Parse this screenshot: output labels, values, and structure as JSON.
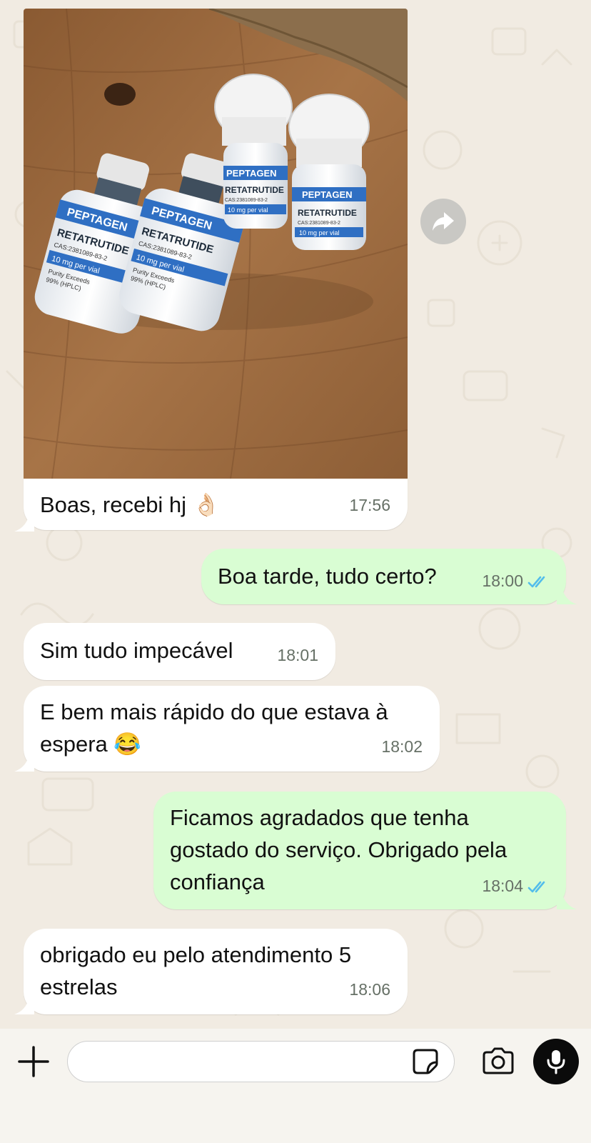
{
  "messages": [
    {
      "id": "m1",
      "dir": "in",
      "text": "Boas, recebi hj 👌🏻",
      "time": "17:56",
      "has_photo": true
    },
    {
      "id": "m2",
      "dir": "out",
      "text": "Boa tarde, tudo certo?",
      "time": "18:00",
      "status": "read"
    },
    {
      "id": "m3",
      "dir": "in",
      "text": "Sim tudo impecável",
      "time": "18:01"
    },
    {
      "id": "m4",
      "dir": "in",
      "text": "E bem mais rápido do que estava à\nespera 😂",
      "time": "18:02"
    },
    {
      "id": "m5",
      "dir": "out",
      "text": "Ficamos agradados que tenha\ngostado do serviço. Obrigado pela\nconfiança",
      "time": "18:04",
      "status": "read"
    },
    {
      "id": "m6",
      "dir": "in",
      "text": "obrigado eu pelo atendimento 5\nestrelas",
      "time": "18:06"
    }
  ],
  "photo": {
    "vials": [
      {
        "brand": "PEPTAGEN",
        "product": "RETATRUTIDE",
        "cas": "CAS:2381089-83-2",
        "dose": "10 mg per vial",
        "purity": "Purity Exceeds",
        "hplc": "99% (HPLC)"
      },
      {
        "brand": "PEPTAGEN",
        "product": "RETATRUTIDE",
        "cas": "CAS:2381089-83-2",
        "dose": "10 mg per vial",
        "purity": "Purity Exceeds",
        "hplc": "99% (HPLC)"
      },
      {
        "brand": "PEPTAGEN",
        "product": "RETATRUTIDE",
        "cas": "CAS:2381089-83-2",
        "dose": "10 mg per vial"
      },
      {
        "brand": "PEPTAGEN",
        "product": "RETATRUTIDE",
        "cas": "CAS:2381089-83-2",
        "dose": "10 mg per vial"
      }
    ]
  },
  "input": {
    "placeholder": "",
    "value": ""
  },
  "icons": {
    "forward": "forward-icon",
    "plus": "plus-icon",
    "sticker": "sticker-icon",
    "camera": "camera-icon",
    "mic": "microphone-icon",
    "read_ticks": "double-check-icon"
  },
  "colors": {
    "incoming": "#ffffff",
    "outgoing": "#d9fdd3",
    "read_ticks": "#53bdeb",
    "background": "#f1ebe2"
  }
}
